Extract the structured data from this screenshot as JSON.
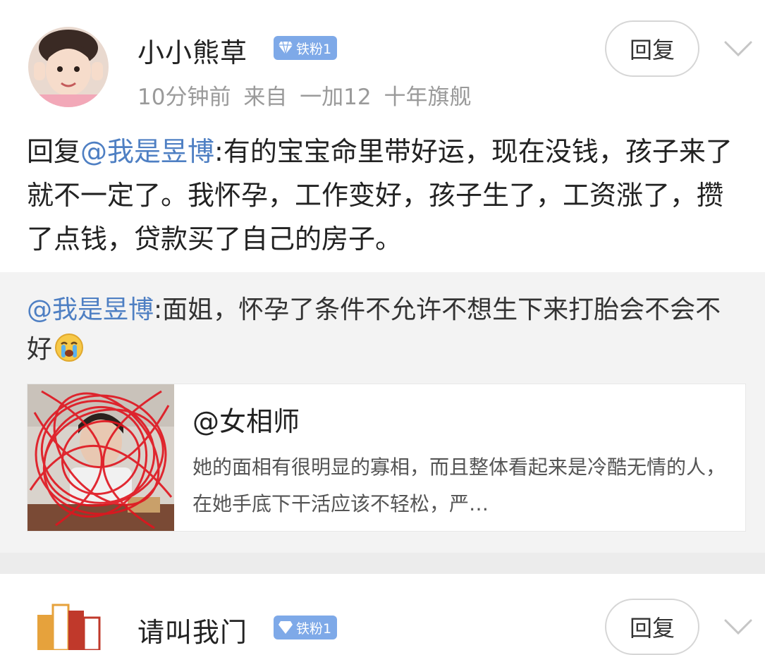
{
  "comment1": {
    "username": "小小熊草",
    "badge": "铁粉1",
    "time": "10分钟前",
    "source": "来自 一加12 十年旗舰",
    "reply_button": "回复",
    "reply_prefix": "回复",
    "reply_mention": "@我是昱博",
    "reply_body": ":有的宝宝命里带好运，现在没钱，孩子来了就不一定了。我怀孕，工作变好，孩子生了，工资涨了，攒了点钱，贷款买了自己的房子。",
    "quoted": {
      "mention": "@我是昱博",
      "text": ":面姐，怀孕了条件不允许不想生下来打胎会不会不好",
      "emoji": "crying-emoji"
    },
    "card": {
      "title": "@女相师",
      "description": "她的面相有很明显的寡相，而且整体看起来是冷酷无情的人，在她手底下干活应该不轻松，严…"
    }
  },
  "comment2": {
    "username": "请叫我门",
    "badge": "铁粉1",
    "reply_button": "回复"
  },
  "colors": {
    "mention": "#4e7fc3",
    "badge": "#7ea9e8",
    "meta": "#9a9a9a",
    "quoted_bg": "#f3f3f3"
  }
}
